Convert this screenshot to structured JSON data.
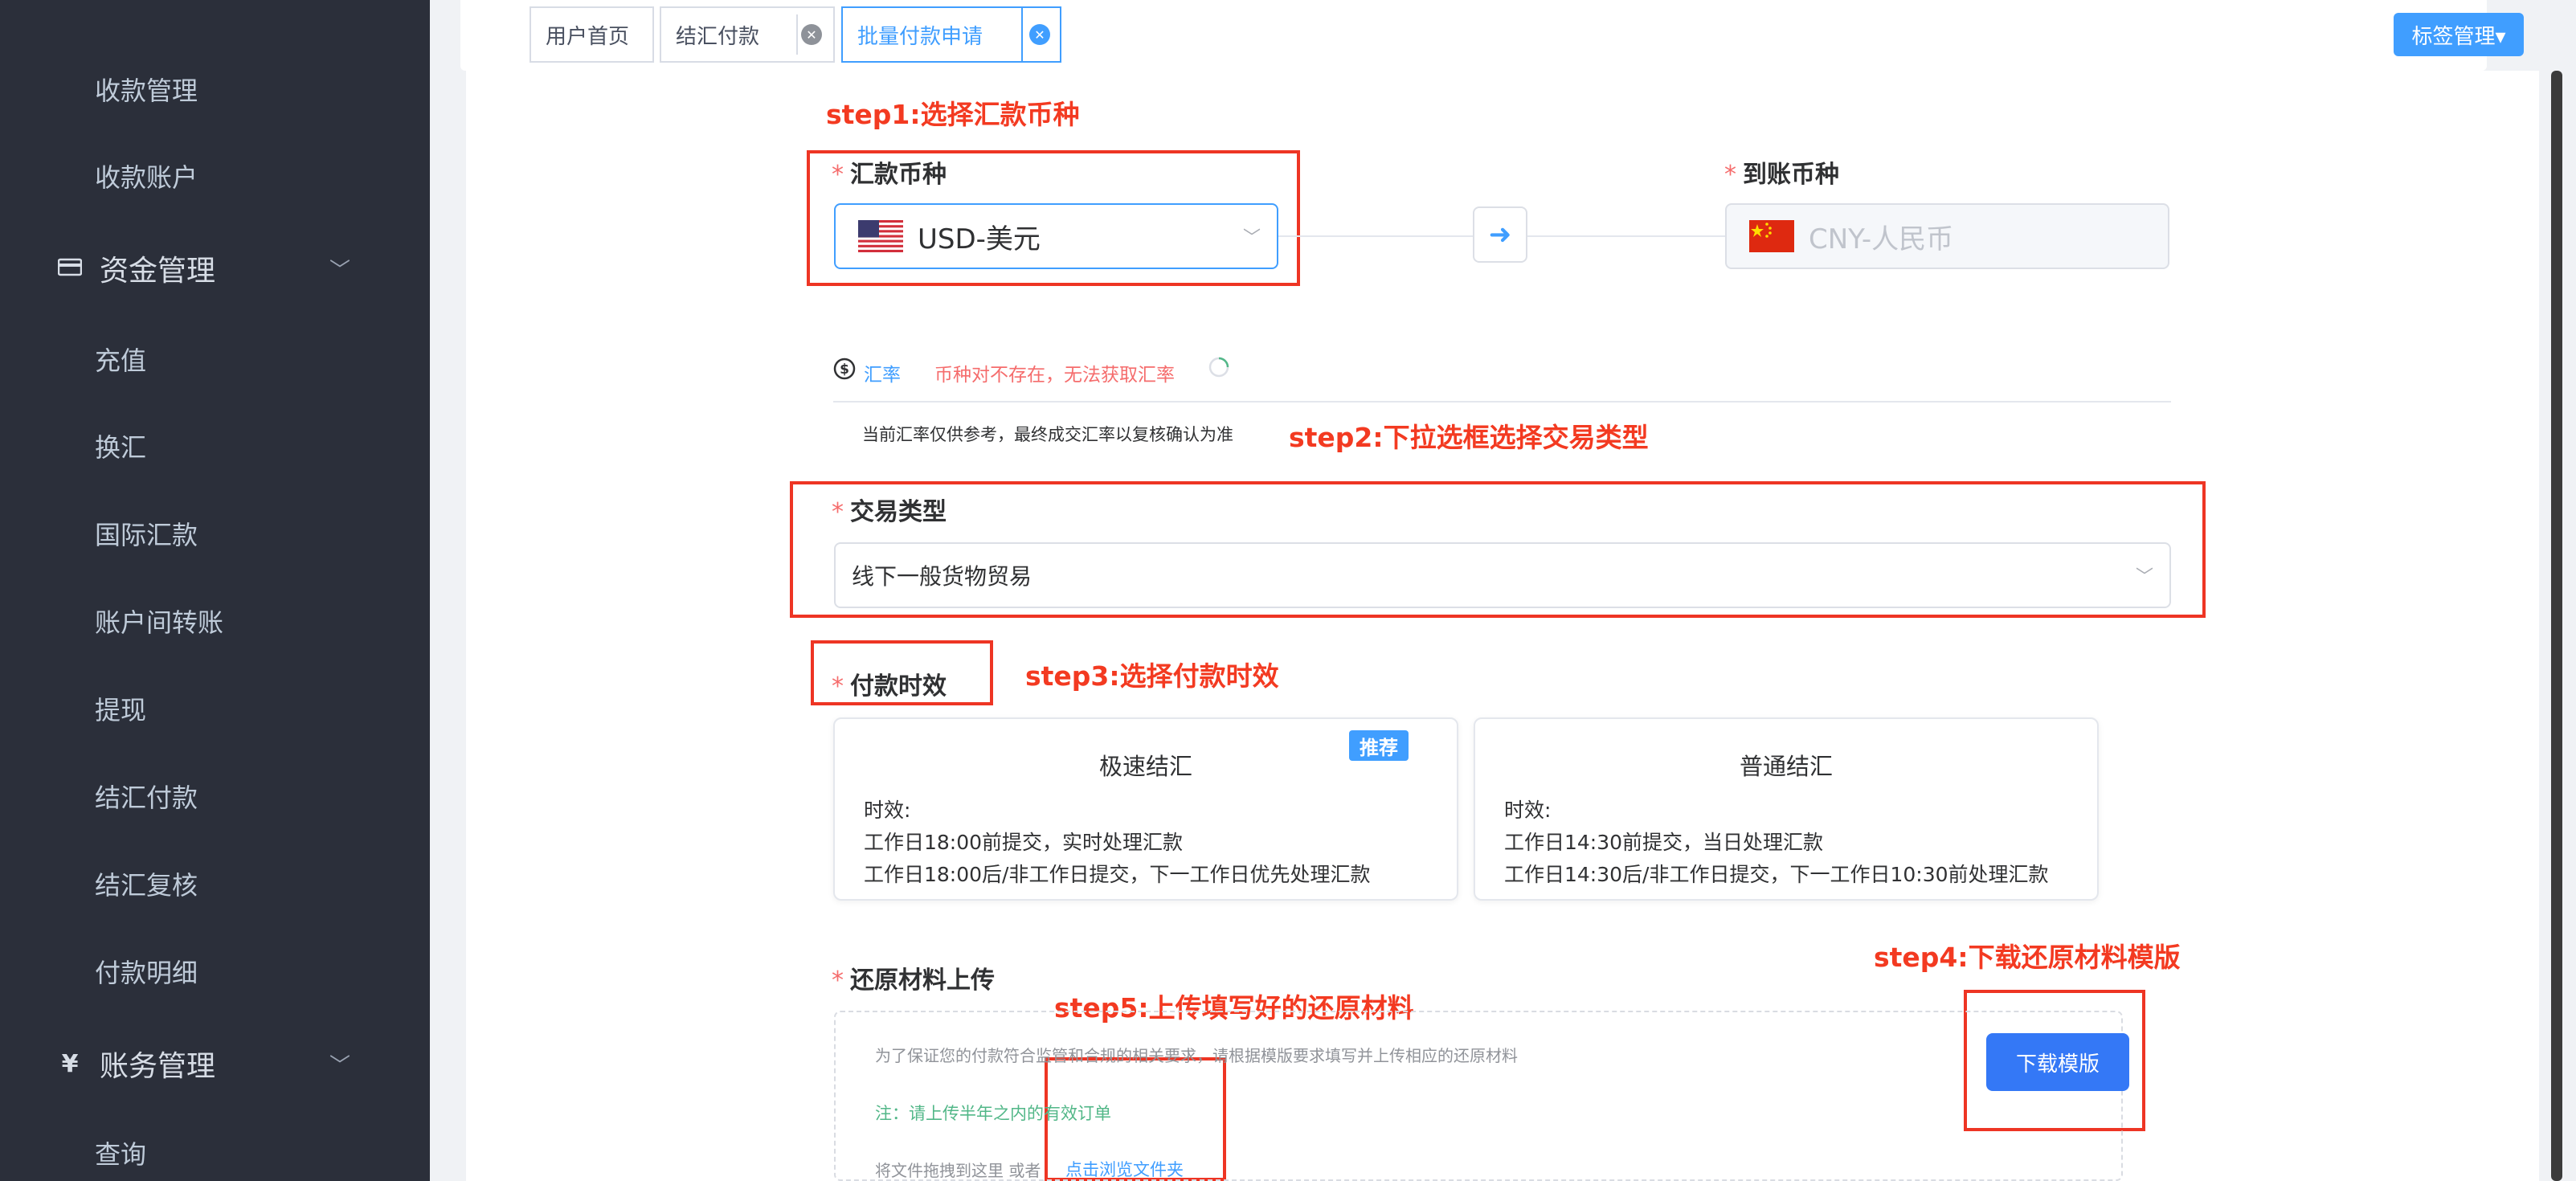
{
  "sidebar": {
    "items": [
      {
        "label": "收款管理"
      },
      {
        "label": "收款账户"
      }
    ],
    "fund_group": {
      "icon": "card-icon",
      "label": "资金管理"
    },
    "fund_items": [
      {
        "label": "充值"
      },
      {
        "label": "换汇"
      },
      {
        "label": "国际汇款"
      },
      {
        "label": "账户间转账"
      },
      {
        "label": "提现"
      },
      {
        "label": "结汇付款"
      },
      {
        "label": "结汇复核"
      },
      {
        "label": "付款明细"
      }
    ],
    "account_group": {
      "icon": "yen-icon",
      "label": "账务管理"
    },
    "account_items": [
      {
        "label": "查询"
      }
    ]
  },
  "tags_view": {
    "tabs": [
      {
        "label": "用户首页"
      },
      {
        "label": "结汇付款"
      },
      {
        "label": "批量付款申请"
      }
    ],
    "tag_manager": "标签管理▾"
  },
  "annotations": {
    "step1": "step1:选择汇款币种",
    "step2": "step2:下拉选框选择交易类型",
    "step3": "step3:选择付款时效",
    "step4": "step4:下载还原材料模版",
    "step5": "step5:上传填写好的还原材料"
  },
  "form": {
    "required_mark": "*",
    "send_currency": {
      "label": "汇款币种",
      "value": "USD-美元",
      "flag": "us-flag-icon"
    },
    "receive_currency": {
      "label": "到账币种",
      "value": "CNY-人民币",
      "flag": "cn-flag-icon"
    },
    "rate": {
      "label": "汇率",
      "error": "币种对不存在，无法获取汇率",
      "note": "当前汇率仅供参考，最终成交汇率以复核确认为准"
    },
    "trade_type": {
      "label": "交易类型",
      "value": "线下一般货物贸易"
    },
    "timeliness": {
      "label": "付款时效",
      "options": [
        {
          "title": "极速结汇",
          "badge": "推荐",
          "lines": [
            "时效:",
            "工作日18:00前提交，实时处理汇款",
            "工作日18:00后/非工作日提交，下一工作日优先处理汇款"
          ]
        },
        {
          "title": "普通结汇",
          "lines": [
            "时效:",
            "工作日14:30前提交，当日处理汇款",
            "工作日14:30后/非工作日提交，下一工作日10:30前处理汇款"
          ]
        }
      ]
    },
    "materials": {
      "label": "还原材料上传",
      "hint": "为了保证您的付款符合监管和合规的相关要求，请根据模版要求填写并上传相应的还原材料",
      "note": "注：请上传半年之内的有效订单",
      "drop_text": "将文件拖拽到这里 或者",
      "browse_link": "点击浏览文件夹",
      "download_button": "下载模版"
    }
  },
  "colors": {
    "sidebar_bg": "#2b2f3a",
    "accent": "#409eff",
    "annotation": "#f33a21",
    "error": "#f56c6c",
    "note_green": "#52b788"
  }
}
